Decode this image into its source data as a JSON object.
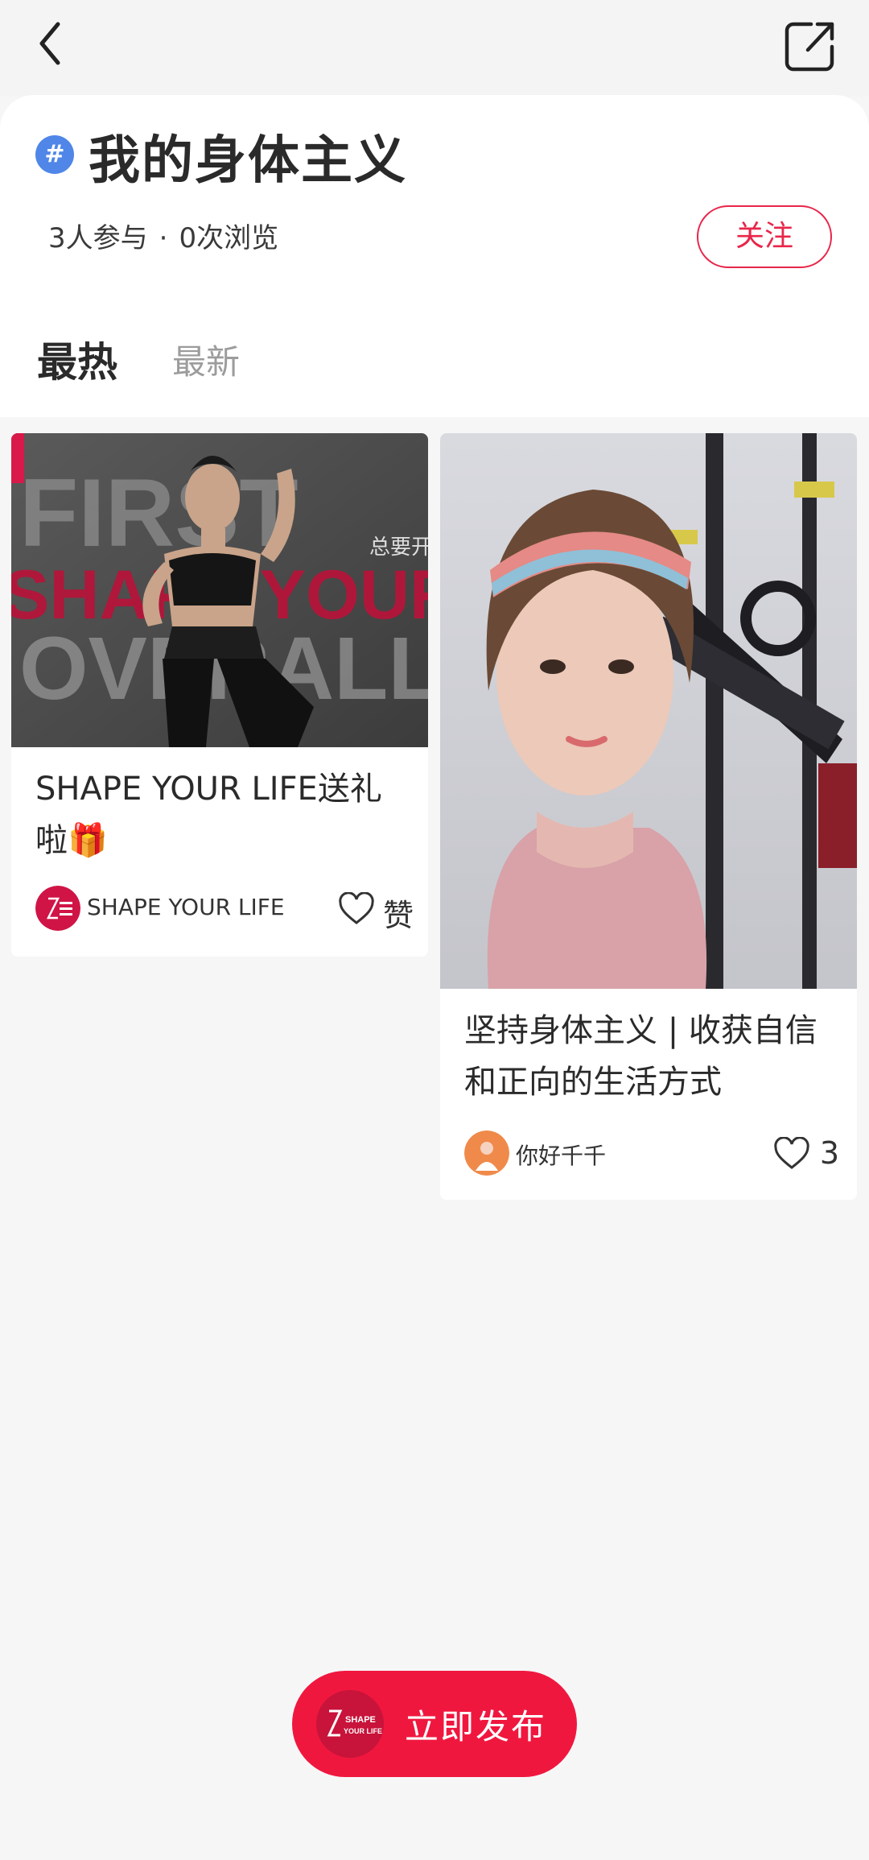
{
  "nav": {
    "back_icon": "chevron-left-icon",
    "share_icon": "external-share-icon"
  },
  "topic": {
    "hash_symbol": "#",
    "title": "我的身体主义",
    "participants": "3人参与",
    "separator": "·",
    "views": "0次浏览",
    "follow_label": "关注"
  },
  "tabs": [
    {
      "label": "最热",
      "active": true
    },
    {
      "label": "最新",
      "active": false
    }
  ],
  "posts": [
    {
      "title": "SHAPE YOUR LIFE送礼啦🎁",
      "author": "SHAPE YOUR LIFE",
      "like_label": "赞",
      "image_text": {
        "line1": "FIRST",
        "line2": "SHAPE YOUR LIFE",
        "line3": "OVERALL",
        "side": "总要开"
      }
    },
    {
      "title": "坚持身体主义 | 收获自信和正向的生活方式",
      "author": "你好千千",
      "like_label": "3"
    }
  ],
  "publish": {
    "label": "立即发布",
    "logo_text_1": "SHAPE",
    "logo_text_2": "YOUR LIFE"
  },
  "colors": {
    "accent": "#f0173f",
    "follow_border": "#e8264a",
    "hash_badge": "#4f86e8",
    "inactive_tab": "#9c9c9c"
  }
}
